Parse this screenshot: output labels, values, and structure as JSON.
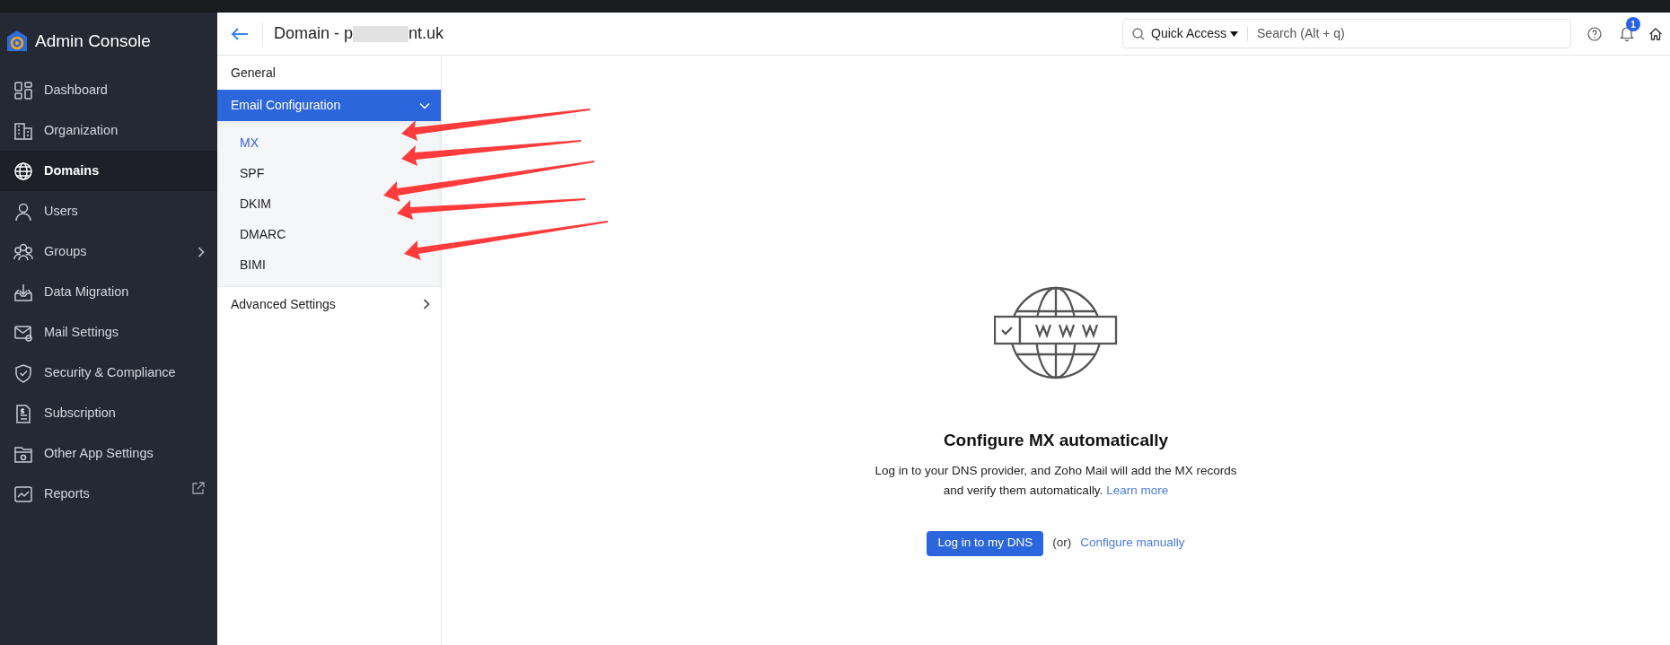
{
  "app": {
    "title": "Admin Console"
  },
  "sidebar": {
    "items": [
      {
        "label": "Dashboard",
        "kind": "page",
        "selected": false
      },
      {
        "label": "Organization",
        "kind": "page",
        "selected": false
      },
      {
        "label": "Domains",
        "kind": "page",
        "selected": true
      },
      {
        "label": "Users",
        "kind": "page",
        "selected": false
      },
      {
        "label": "Groups",
        "kind": "group",
        "selected": false
      },
      {
        "label": "Data Migration",
        "kind": "page",
        "selected": false
      },
      {
        "label": "Mail Settings",
        "kind": "page",
        "selected": false
      },
      {
        "label": "Security & Compliance",
        "kind": "page",
        "selected": false
      },
      {
        "label": "Subscription",
        "kind": "page",
        "selected": false
      },
      {
        "label": "Other App Settings",
        "kind": "page",
        "selected": false
      },
      {
        "label": "Reports",
        "kind": "external",
        "selected": false
      }
    ]
  },
  "header": {
    "title_start": "Domain - p",
    "title_end": "nt.uk",
    "quick_access": "Quick Access",
    "search": {
      "placeholder": "Search (Alt + q)"
    },
    "notification_count": "1"
  },
  "settings_menu": [
    {
      "label": "General",
      "kind": "page",
      "selected": false
    },
    {
      "label": "Email Configuration",
      "kind": "section",
      "selected": true,
      "expanded": true,
      "children": [
        {
          "label": "MX",
          "selected": true
        },
        {
          "label": "SPF",
          "selected": false
        },
        {
          "label": "DKIM",
          "selected": false
        },
        {
          "label": "DMARC",
          "selected": false
        },
        {
          "label": "BIMI",
          "selected": false
        }
      ]
    },
    {
      "label": "Advanced Settings",
      "kind": "section",
      "selected": false,
      "expanded": false
    }
  ],
  "content": {
    "heading": "Configure MX automatically",
    "description_line_1": "Log in to your DNS provider, and Zoho Mail will add the MX records",
    "description_line_2": "and verify them automatically.",
    "learn_more": "Learn more",
    "primary_button": "Log in to my DNS",
    "separator": "(or)",
    "secondary_link": "Configure manually"
  }
}
